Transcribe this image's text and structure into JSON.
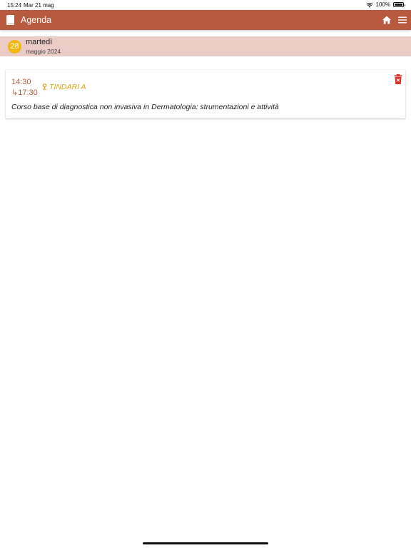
{
  "status_bar": {
    "time": "15:24",
    "date": "Mar 21 mag",
    "battery": "100%",
    "icons": [
      "wifi-icon",
      "battery-icon"
    ]
  },
  "app_bar": {
    "title": "Agenda",
    "icons": [
      "book-icon",
      "home-icon",
      "menu-icon"
    ],
    "color": "#b85a3e"
  },
  "day": {
    "number": "28",
    "weekday": "martedì",
    "month_year": "maggio 2024",
    "badge_color": "#f1b70f",
    "header_bg": "#ebcbc6"
  },
  "events": [
    {
      "start": "14:30",
      "end": "↳17:30",
      "location": "TINDARI A",
      "title": "Corso base di diagnostica non invasiva in Dermatologia: strumentazioni e attività",
      "delete_icon": "trash-icon",
      "location_icon": "pin-icon",
      "delete_color": "#d9352b",
      "location_color": "#e3a516"
    }
  ]
}
